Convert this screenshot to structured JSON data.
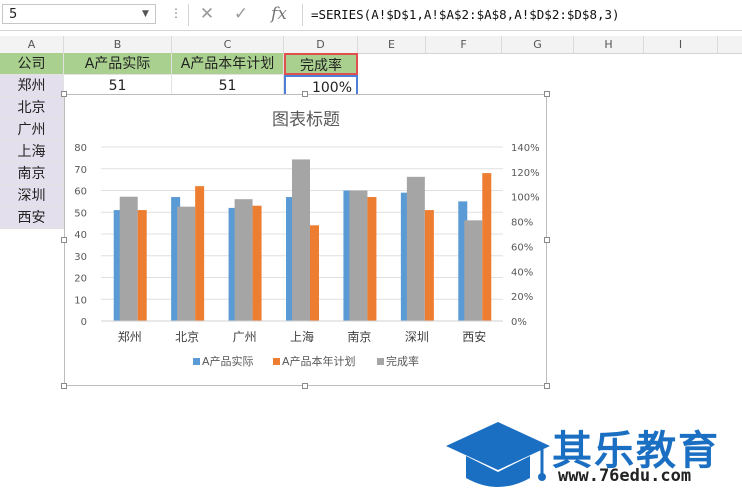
{
  "formula_bar": {
    "name_box": "5",
    "formula": "=SERIES(A!$D$1,A!$A$2:$A$8,A!$D$2:$D$8,3)"
  },
  "columns": [
    "A",
    "B",
    "C",
    "D",
    "E",
    "F",
    "G",
    "H",
    "I"
  ],
  "table": {
    "headers": [
      "公司",
      "A产品实际",
      "A产品本年计划",
      "完成率"
    ],
    "row1": [
      "郑州",
      "51",
      "51",
      "100%"
    ],
    "cities": [
      "郑州",
      "北京",
      "广州",
      "上海",
      "南京",
      "深圳",
      "西安"
    ]
  },
  "chart_data": {
    "type": "bar",
    "title": "图表标题",
    "categories": [
      "郑州",
      "北京",
      "广州",
      "上海",
      "南京",
      "深圳",
      "西安"
    ],
    "series": [
      {
        "name": "A产品实际",
        "values": [
          51,
          57,
          52,
          57,
          60,
          59,
          55
        ],
        "axis": "left",
        "color": "#5b9bd5"
      },
      {
        "name": "A产品本年计划",
        "values": [
          51,
          62,
          53,
          44,
          57,
          51,
          68
        ],
        "axis": "left",
        "color": "#ed7d31"
      },
      {
        "name": "完成率",
        "values": [
          1.0,
          0.92,
          0.98,
          1.3,
          1.05,
          1.16,
          0.81
        ],
        "axis": "right",
        "color": "#a5a5a5"
      }
    ],
    "y_left": {
      "ticks": [
        "0",
        "10",
        "20",
        "30",
        "40",
        "50",
        "60",
        "70",
        "80"
      ],
      "min": 0,
      "max": 80
    },
    "y_right": {
      "ticks": [
        "0%",
        "20%",
        "40%",
        "60%",
        "80%",
        "100%",
        "120%",
        "140%"
      ],
      "min": 0,
      "max": 1.4
    },
    "legend_position": "bottom",
    "grid": true
  },
  "logo": {
    "name": "其乐教育",
    "url": "www.76edu.com",
    "color": "#1b6fc2"
  }
}
